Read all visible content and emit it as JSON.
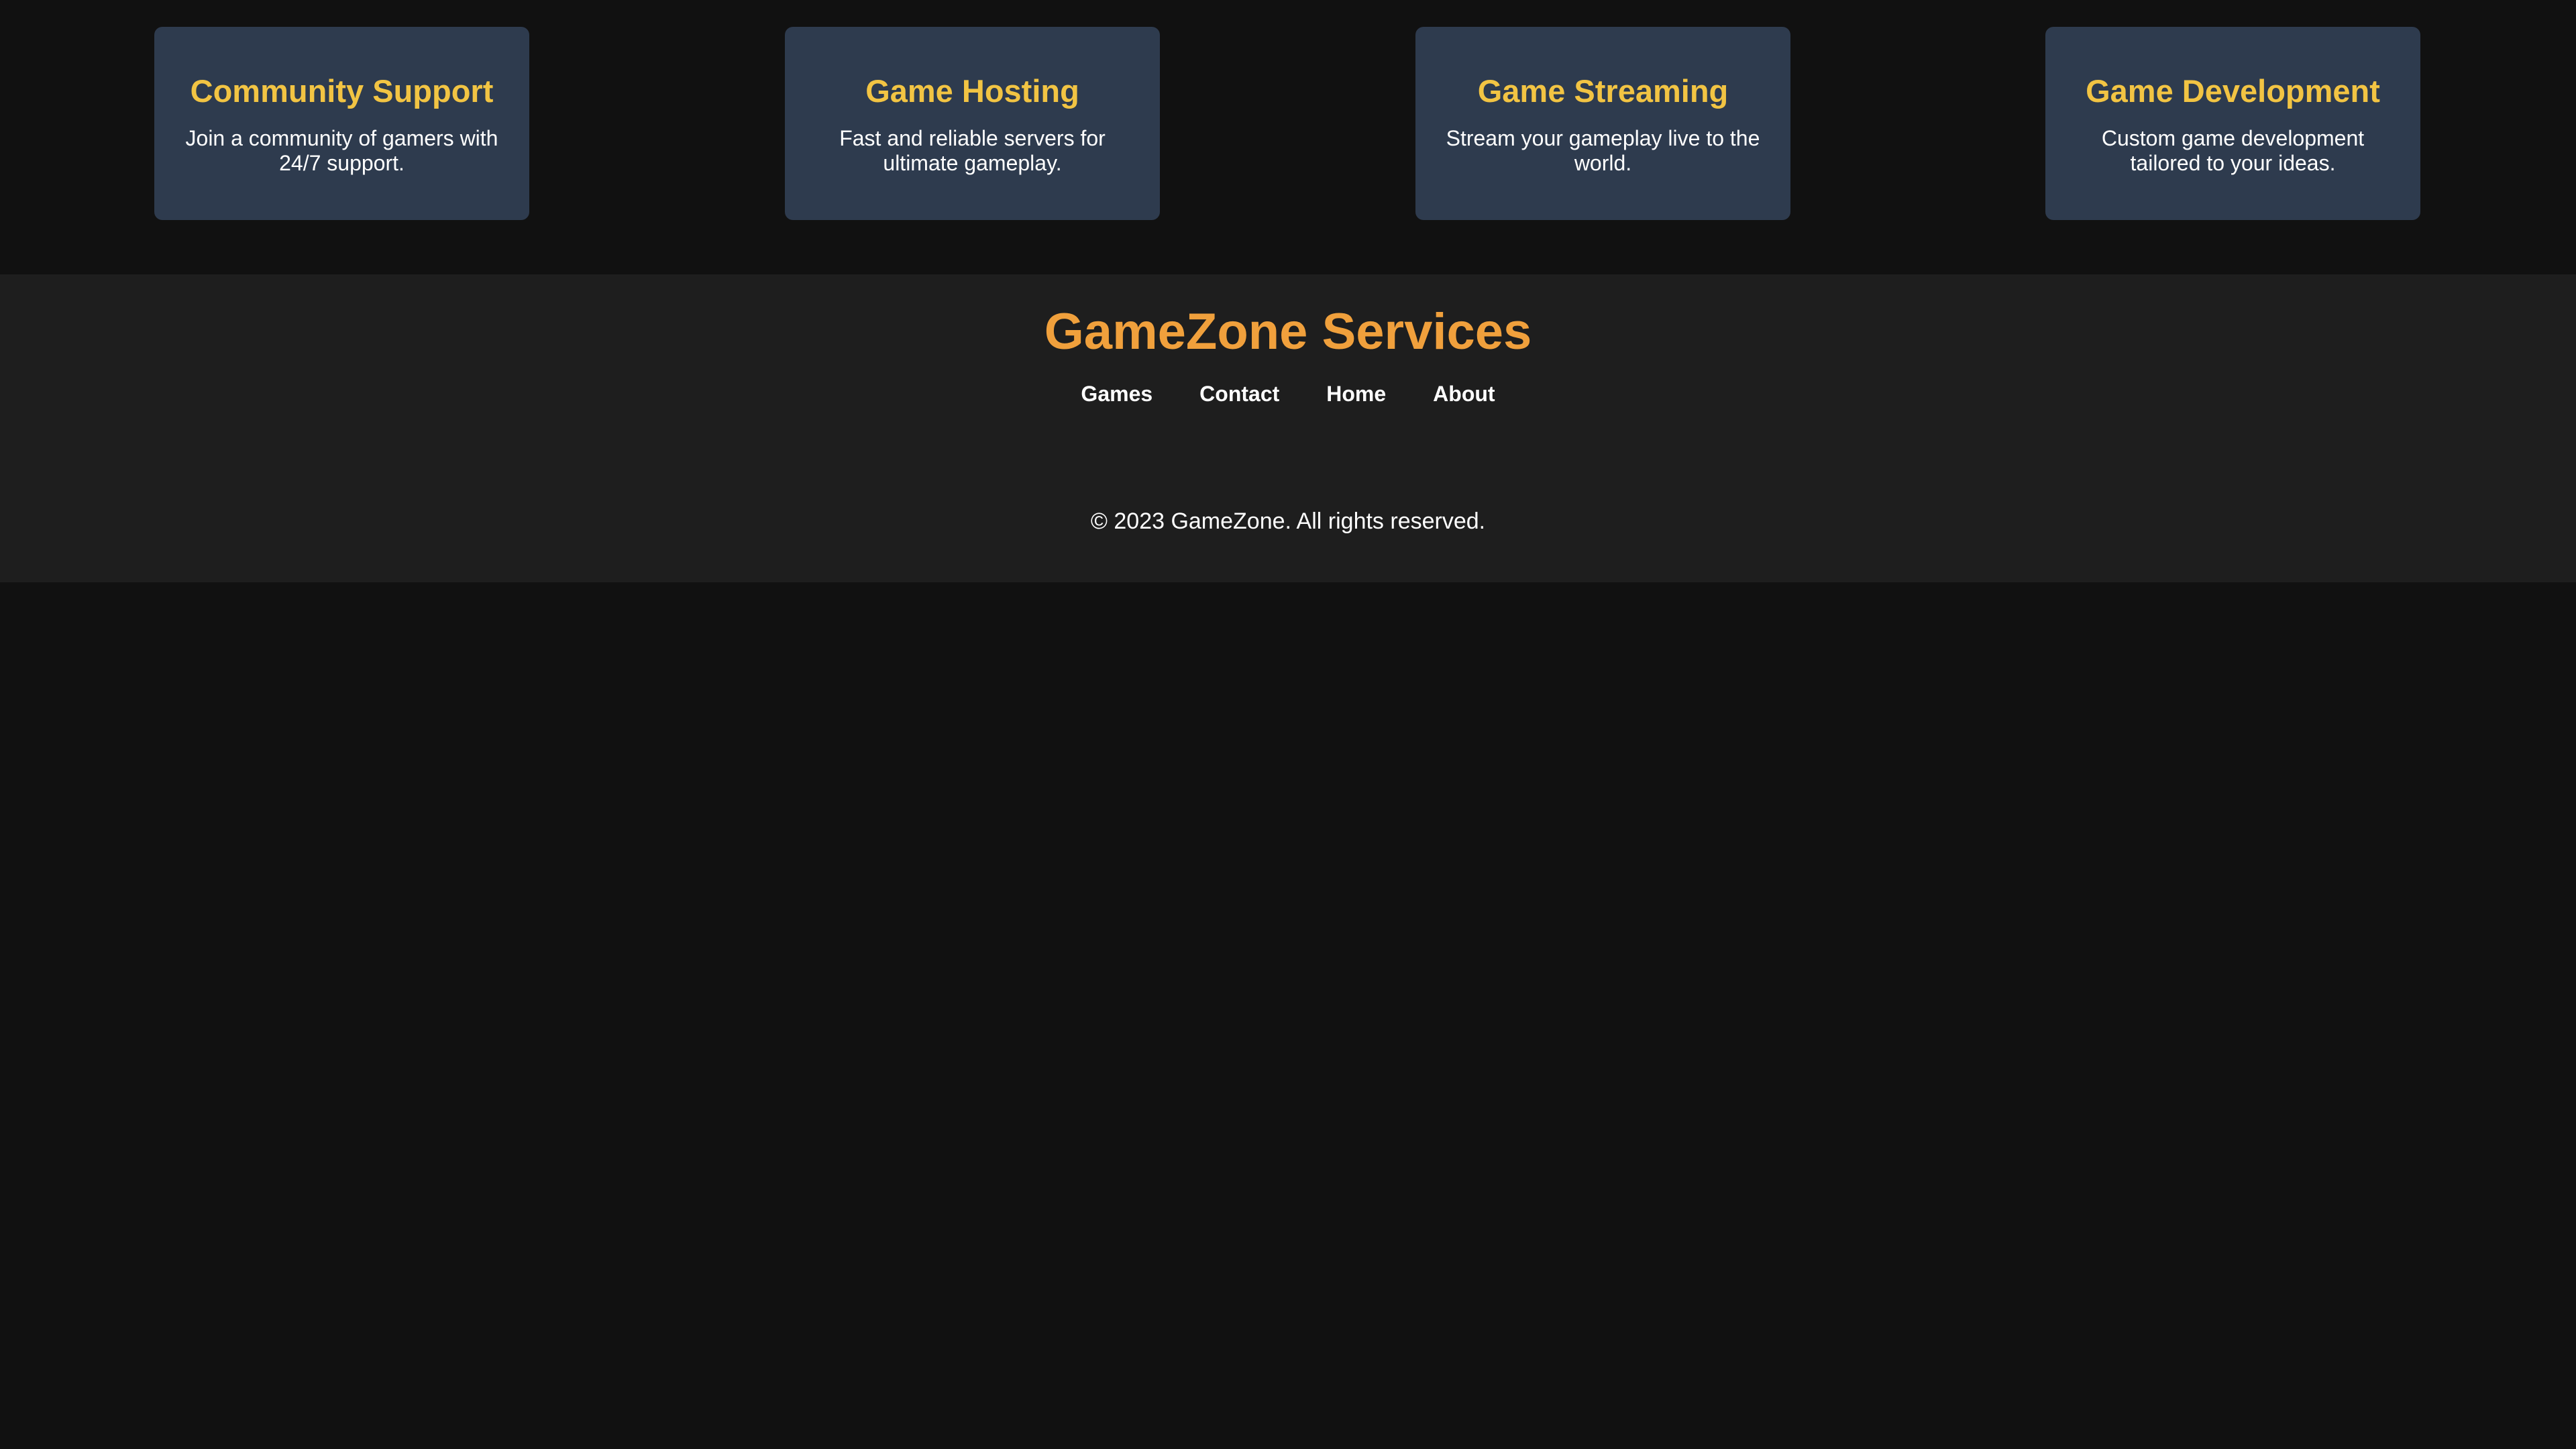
{
  "colors": {
    "page_background": "#111111",
    "card_background": "#2e3b4e",
    "card_title": "#f2c443",
    "footer_background": "#1e1e1e",
    "brand": "#f0a03c",
    "text": "#ffffff"
  },
  "services": [
    {
      "title": "Community Support",
      "description": "Join a community of gamers with 24/7 support."
    },
    {
      "title": "Game Hosting",
      "description": "Fast and reliable servers for ultimate gameplay."
    },
    {
      "title": "Game Streaming",
      "description": "Stream your gameplay live to the world."
    },
    {
      "title": "Game Development",
      "description": "Custom game development tailored to your ideas."
    }
  ],
  "footer": {
    "brand": "GameZone Services",
    "nav": [
      "Games",
      "Contact",
      "Home",
      "About"
    ],
    "copyright": "© 2023 GameZone. All rights reserved."
  }
}
